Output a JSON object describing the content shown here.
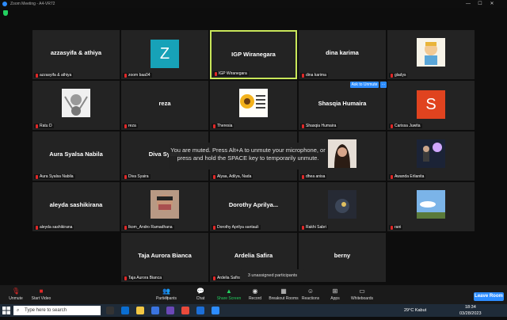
{
  "window": {
    "title": "Zoom Meeting - A4-VR72"
  },
  "tiles": [
    {
      "row": 0,
      "col": 0,
      "name": "azzasyifa & athiya",
      "label": "azzasyifa & athiya",
      "type": "name"
    },
    {
      "row": 0,
      "col": 1,
      "name": "",
      "label": "zoom baa04",
      "type": "avatar",
      "letter": "Z",
      "color": "#17a2b8"
    },
    {
      "row": 0,
      "col": 2,
      "name": "IGP Wiranegara",
      "label": "IGP Wiranegara",
      "type": "name",
      "active": true
    },
    {
      "row": 0,
      "col": 3,
      "name": "dina karima",
      "label": "dina karima",
      "type": "name"
    },
    {
      "row": 0,
      "col": 4,
      "name": "",
      "label": "gladys",
      "type": "photo",
      "pic": "cartoon"
    },
    {
      "row": 1,
      "col": 0,
      "name": "",
      "label": "Ratu D",
      "type": "photo",
      "pic": "wings"
    },
    {
      "row": 1,
      "col": 1,
      "name": "reza",
      "label": "reza",
      "type": "name"
    },
    {
      "row": 1,
      "col": 2,
      "name": "",
      "label": "Theresia",
      "type": "photo",
      "pic": "sunflower"
    },
    {
      "row": 1,
      "col": 3,
      "name": "Shasqia Humaira",
      "label": "Shasqia Humaira",
      "type": "name"
    },
    {
      "row": 1,
      "col": 4,
      "name": "",
      "label": "Carissa Juwita",
      "type": "avatar",
      "letter": "S",
      "color": "#e0431f"
    },
    {
      "row": 2,
      "col": 0,
      "name": "Aura Syalsa Nabila",
      "label": "Aura Syalsa Nabila",
      "type": "name"
    },
    {
      "row": 2,
      "col": 1,
      "name": "Diva Syaira",
      "label": "Diva Syaira",
      "type": "name"
    },
    {
      "row": 2,
      "col": 2,
      "name": "",
      "label": "Alyaa, Adilya, Nada",
      "type": "blank"
    },
    {
      "row": 2,
      "col": 3,
      "name": "",
      "label": "dhea anisa",
      "type": "photo",
      "pic": "girl"
    },
    {
      "row": 2,
      "col": 4,
      "name": "",
      "label": "Awanda Erlianita",
      "type": "photo",
      "pic": "guitar"
    },
    {
      "row": 3,
      "col": 0,
      "name": "aleyda sashikirana",
      "label": "aleyda sashikirana",
      "type": "name"
    },
    {
      "row": 3,
      "col": 1,
      "name": "",
      "label": "Ikom_Andro Ramadhana",
      "type": "photo",
      "pic": "mask"
    },
    {
      "row": 3,
      "col": 2,
      "name": "Dorothy  Aprilya...",
      "label": "Dorothy Aprilya santauli",
      "type": "name"
    },
    {
      "row": 3,
      "col": 3,
      "name": "",
      "label": "Rakhi Sabri",
      "type": "photo",
      "pic": "dark"
    },
    {
      "row": 3,
      "col": 4,
      "name": "",
      "label": "rani",
      "type": "photo",
      "pic": "sky"
    },
    {
      "row": 4,
      "col": 1,
      "name": "Taja Aurora Bianca",
      "label": "Taja Aurora Bianca",
      "type": "name"
    },
    {
      "row": 4,
      "col": 2,
      "name": "Ardelia Safira",
      "label": "Ardelia Safira",
      "type": "name"
    },
    {
      "row": 4,
      "col": 3,
      "name": "berny",
      "label": "",
      "type": "name"
    }
  ],
  "toast": {
    "line1": "You are muted. Press Alt+A to unmute your microphone, or",
    "line2": "press and hold the SPACE key to temporarily unmute."
  },
  "ask_to_unmute": "Ask to Unmute",
  "ask_more": "...",
  "unassigned": "3 unassigned participants",
  "toolbar": {
    "unmute": "Unmute",
    "start_video": "Start Video",
    "participants": "Participants",
    "participants_count": "23",
    "chat": "Chat",
    "share_screen": "Share Screen",
    "record": "Record",
    "breakout_rooms": "Breakout Rooms",
    "reactions": "Reactions",
    "apps": "Apps",
    "whiteboards": "Whiteboards",
    "leave": "Leave Room"
  },
  "taskbar": {
    "search_placeholder": "Type here to search",
    "weather": "29°C  Kabut",
    "time": "18:34",
    "date": "03/28/2023"
  },
  "colors": {
    "accent": "#2d8cff",
    "active_border": "#c8e65a",
    "share_green": "#23d160"
  }
}
